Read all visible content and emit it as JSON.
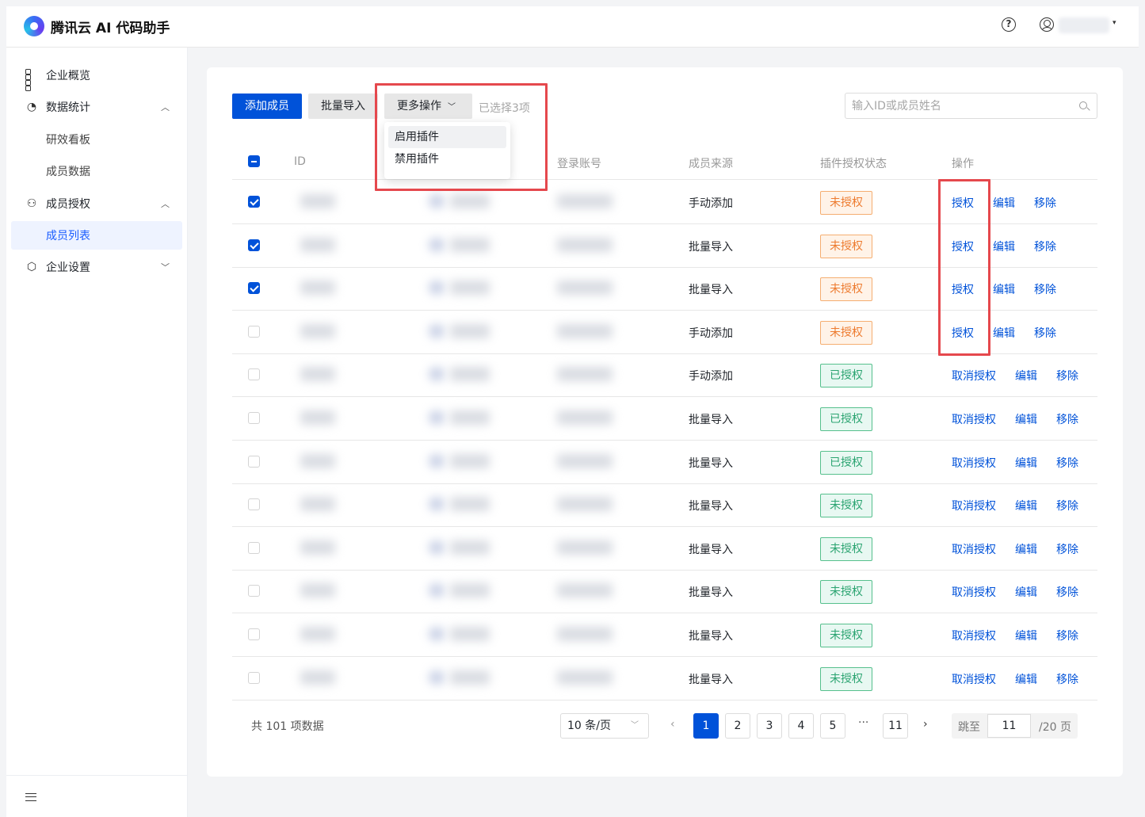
{
  "header": {
    "app_name": "腾讯云 AI 代码助手",
    "help_icon_glyph": "?"
  },
  "sidebar": {
    "items": [
      {
        "label": "企业概览",
        "icon": "dashboard-grid-icon"
      },
      {
        "label": "数据统计",
        "icon": "gauge-icon",
        "expanded": true
      },
      {
        "label": "研效看板",
        "sub": true
      },
      {
        "label": "成员数据",
        "sub": true
      },
      {
        "label": "成员授权",
        "icon": "users-icon",
        "expanded": true
      },
      {
        "label": "成员列表",
        "sub": true,
        "active": true
      },
      {
        "label": "企业设置",
        "icon": "settings-icon",
        "expanded": false
      }
    ]
  },
  "toolbar": {
    "add_label": "添加成员",
    "import_label": "批量导入",
    "more_label": "更多操作",
    "selected_text": "已选择3项",
    "search_placeholder": "输入ID或成员姓名"
  },
  "dropdown": {
    "items": [
      "启用插件",
      "禁用插件"
    ]
  },
  "table": {
    "headers": {
      "id": "ID",
      "account": "登录账号",
      "source": "成员来源",
      "status": "插件授权状态",
      "ops": "操作"
    },
    "rows": [
      {
        "checked": true,
        "source": "手动添加",
        "status": "未授权",
        "status_color": "orange",
        "actions": [
          "授权",
          "编辑",
          "移除"
        ]
      },
      {
        "checked": true,
        "source": "批量导入",
        "status": "未授权",
        "status_color": "orange",
        "actions": [
          "授权",
          "编辑",
          "移除"
        ]
      },
      {
        "checked": true,
        "source": "批量导入",
        "status": "未授权",
        "status_color": "orange",
        "actions": [
          "授权",
          "编辑",
          "移除"
        ]
      },
      {
        "checked": false,
        "source": "手动添加",
        "status": "未授权",
        "status_color": "orange",
        "actions": [
          "授权",
          "编辑",
          "移除"
        ]
      },
      {
        "checked": false,
        "source": "手动添加",
        "status": "已授权",
        "status_color": "green",
        "actions": [
          "取消授权",
          "编辑",
          "移除"
        ]
      },
      {
        "checked": false,
        "source": "批量导入",
        "status": "已授权",
        "status_color": "green",
        "actions": [
          "取消授权",
          "编辑",
          "移除"
        ]
      },
      {
        "checked": false,
        "source": "批量导入",
        "status": "已授权",
        "status_color": "green",
        "actions": [
          "取消授权",
          "编辑",
          "移除"
        ]
      },
      {
        "checked": false,
        "source": "批量导入",
        "status": "未授权",
        "status_color": "green",
        "actions": [
          "取消授权",
          "编辑",
          "移除"
        ]
      },
      {
        "checked": false,
        "source": "批量导入",
        "status": "未授权",
        "status_color": "green",
        "actions": [
          "取消授权",
          "编辑",
          "移除"
        ]
      },
      {
        "checked": false,
        "source": "批量导入",
        "status": "未授权",
        "status_color": "green",
        "actions": [
          "取消授权",
          "编辑",
          "移除"
        ]
      },
      {
        "checked": false,
        "source": "批量导入",
        "status": "未授权",
        "status_color": "green",
        "actions": [
          "取消授权",
          "编辑",
          "移除"
        ]
      },
      {
        "checked": false,
        "source": "批量导入",
        "status": "未授权",
        "status_color": "green",
        "actions": [
          "取消授权",
          "编辑",
          "移除"
        ]
      }
    ]
  },
  "pagination": {
    "total_text": "共 101 项数据",
    "page_size": "10 条/页",
    "pages": [
      "1",
      "2",
      "3",
      "4",
      "5",
      "11"
    ],
    "current": "1",
    "ellipsis": "···",
    "jump_label": "跳至",
    "jump_value": "11",
    "total_pages_text": "/20 页"
  },
  "colors": {
    "primary": "#0052d9",
    "highlight": "#e5484d",
    "orange": "#ed7b2f",
    "green": "#2ba471"
  }
}
